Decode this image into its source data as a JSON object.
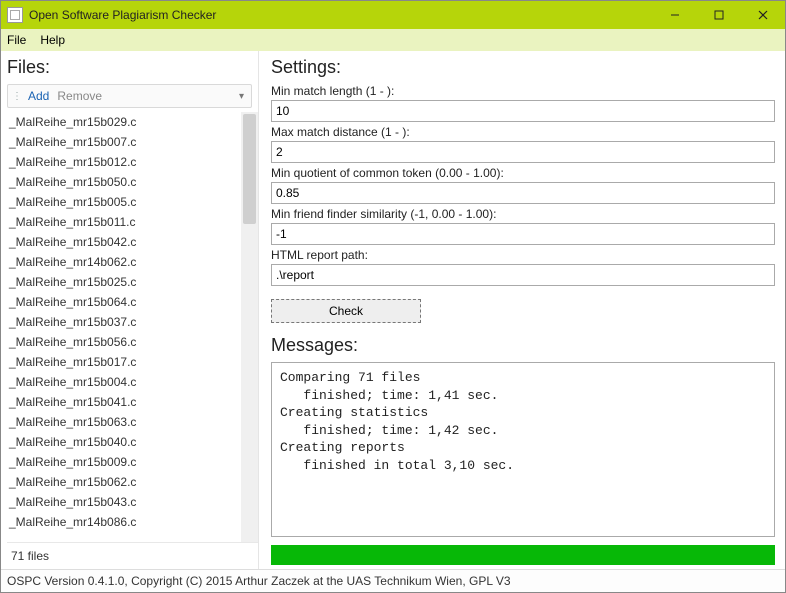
{
  "window": {
    "title": "Open Software Plagiarism Checker"
  },
  "menubar": {
    "file": "File",
    "help": "Help"
  },
  "left": {
    "title": "Files:",
    "toolbar": {
      "add": "Add",
      "remove": "Remove"
    },
    "files": [
      "_MalReihe_mr15b029.c",
      "_MalReihe_mr15b007.c",
      "_MalReihe_mr15b012.c",
      "_MalReihe_mr15b050.c",
      "_MalReihe_mr15b005.c",
      "_MalReihe_mr15b011.c",
      "_MalReihe_mr15b042.c",
      "_MalReihe_mr14b062.c",
      "_MalReihe_mr15b025.c",
      "_MalReihe_mr15b064.c",
      "_MalReihe_mr15b037.c",
      "_MalReihe_mr15b056.c",
      "_MalReihe_mr15b017.c",
      "_MalReihe_mr15b004.c",
      "_MalReihe_mr15b041.c",
      "_MalReihe_mr15b063.c",
      "_MalReihe_mr15b040.c",
      "_MalReihe_mr15b009.c",
      "_MalReihe_mr15b062.c",
      "_MalReihe_mr15b043.c",
      "_MalReihe_mr14b086.c"
    ],
    "footer": "71 files"
  },
  "settings": {
    "title": "Settings:",
    "min_match_len": {
      "label": "Min match length (1 - ):",
      "value": "10"
    },
    "max_match_dist": {
      "label": "Max match distance (1 - ):",
      "value": "2"
    },
    "min_quotient": {
      "label": "Min quotient of common token (0.00 - 1.00):",
      "value": "0.85"
    },
    "min_friend": {
      "label": "Min friend finder similarity (-1, 0.00 - 1.00):",
      "value": "-1"
    },
    "report_path": {
      "label": "HTML report path:",
      "value": ".\\report"
    },
    "check_button": "Check"
  },
  "messages": {
    "title": "Messages:",
    "text": "Comparing 71 files\n   finished; time: 1,41 sec.\nCreating statistics\n   finished; time: 1,42 sec.\nCreating reports\n   finished in total 3,10 sec."
  },
  "statusbar": "OSPC Version 0.4.1.0, Copyright (C) 2015 Arthur Zaczek at the UAS Technikum Wien, GPL V3"
}
